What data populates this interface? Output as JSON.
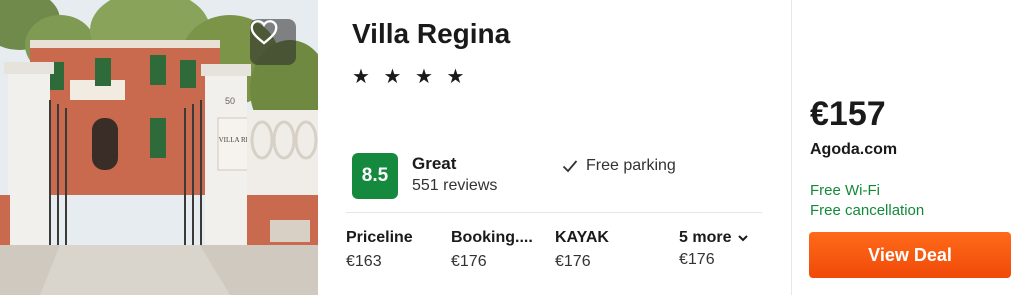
{
  "hotel": {
    "name": "Villa Regina",
    "stars": "★ ★ ★ ★",
    "star_count": 4,
    "rating_score": "8.5",
    "rating_word": "Great",
    "reviews": "551 reviews",
    "amenity": "Free parking",
    "sign_text": "VILLA REGINA",
    "gate_number": "50"
  },
  "providers": [
    {
      "name": "Priceline",
      "price": "€163"
    },
    {
      "name": "Booking....",
      "price": "€176"
    },
    {
      "name": "KAYAK",
      "price": "€176"
    }
  ],
  "more": {
    "label": "5 more",
    "price": "€176"
  },
  "deal": {
    "price": "€157",
    "site": "Agoda.com",
    "features": [
      "Free Wi-Fi",
      "Free cancellation"
    ],
    "button_label": "View Deal"
  },
  "colors": {
    "rating_green": "#158a3e",
    "feature_green": "#138a3a",
    "deal_orange": "#f04a08"
  }
}
